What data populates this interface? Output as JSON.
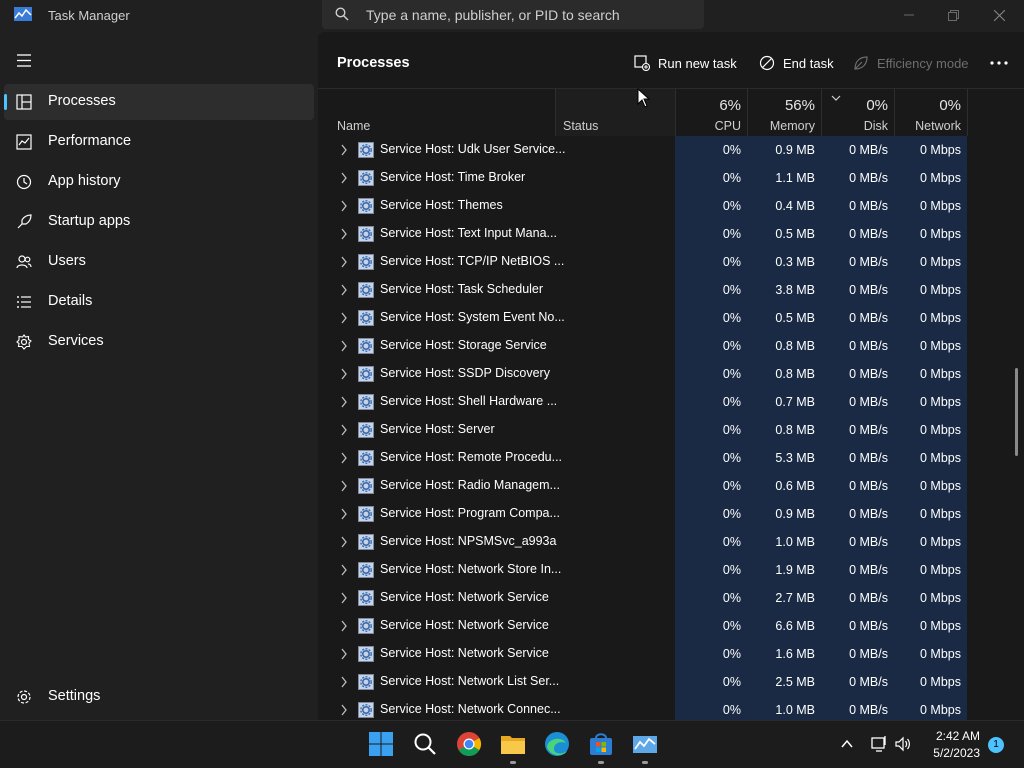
{
  "window": {
    "title": "Task Manager"
  },
  "search": {
    "placeholder": "Type a name, publisher, or PID to search"
  },
  "sidebar": {
    "items": [
      {
        "label": "Processes",
        "icon": "processes-icon",
        "active": true
      },
      {
        "label": "Performance",
        "icon": "performance-icon"
      },
      {
        "label": "App history",
        "icon": "app-history-icon"
      },
      {
        "label": "Startup apps",
        "icon": "startup-apps-icon"
      },
      {
        "label": "Users",
        "icon": "users-icon"
      },
      {
        "label": "Details",
        "icon": "details-icon"
      },
      {
        "label": "Services",
        "icon": "services-icon"
      }
    ],
    "settings_label": "Settings"
  },
  "toolbar": {
    "title": "Processes",
    "run_new_task": "Run new task",
    "end_task": "End task",
    "efficiency_mode": "Efficiency mode"
  },
  "columns": {
    "name": "Name",
    "status": "Status",
    "cpu": {
      "pct": "6%",
      "label": "CPU"
    },
    "memory": {
      "pct": "56%",
      "label": "Memory"
    },
    "disk": {
      "pct": "0%",
      "label": "Disk"
    },
    "network": {
      "pct": "0%",
      "label": "Network"
    }
  },
  "processes": [
    {
      "name": "Service Host: Udk User Service...",
      "cpu": "0%",
      "memory": "0.9 MB",
      "disk": "0 MB/s",
      "network": "0 Mbps"
    },
    {
      "name": "Service Host: Time Broker",
      "cpu": "0%",
      "memory": "1.1 MB",
      "disk": "0 MB/s",
      "network": "0 Mbps"
    },
    {
      "name": "Service Host: Themes",
      "cpu": "0%",
      "memory": "0.4 MB",
      "disk": "0 MB/s",
      "network": "0 Mbps"
    },
    {
      "name": "Service Host: Text Input Mana...",
      "cpu": "0%",
      "memory": "0.5 MB",
      "disk": "0 MB/s",
      "network": "0 Mbps"
    },
    {
      "name": "Service Host: TCP/IP NetBIOS ...",
      "cpu": "0%",
      "memory": "0.3 MB",
      "disk": "0 MB/s",
      "network": "0 Mbps"
    },
    {
      "name": "Service Host: Task Scheduler",
      "cpu": "0%",
      "memory": "3.8 MB",
      "disk": "0 MB/s",
      "network": "0 Mbps"
    },
    {
      "name": "Service Host: System Event No...",
      "cpu": "0%",
      "memory": "0.5 MB",
      "disk": "0 MB/s",
      "network": "0 Mbps"
    },
    {
      "name": "Service Host: Storage Service",
      "cpu": "0%",
      "memory": "0.8 MB",
      "disk": "0 MB/s",
      "network": "0 Mbps"
    },
    {
      "name": "Service Host: SSDP Discovery",
      "cpu": "0%",
      "memory": "0.8 MB",
      "disk": "0 MB/s",
      "network": "0 Mbps"
    },
    {
      "name": "Service Host: Shell Hardware ...",
      "cpu": "0%",
      "memory": "0.7 MB",
      "disk": "0 MB/s",
      "network": "0 Mbps"
    },
    {
      "name": "Service Host: Server",
      "cpu": "0%",
      "memory": "0.8 MB",
      "disk": "0 MB/s",
      "network": "0 Mbps"
    },
    {
      "name": "Service Host: Remote Procedu...",
      "cpu": "0%",
      "memory": "5.3 MB",
      "disk": "0 MB/s",
      "network": "0 Mbps"
    },
    {
      "name": "Service Host: Radio Managem...",
      "cpu": "0%",
      "memory": "0.6 MB",
      "disk": "0 MB/s",
      "network": "0 Mbps"
    },
    {
      "name": "Service Host: Program Compa...",
      "cpu": "0%",
      "memory": "0.9 MB",
      "disk": "0 MB/s",
      "network": "0 Mbps"
    },
    {
      "name": "Service Host: NPSMSvc_a993a",
      "cpu": "0%",
      "memory": "1.0 MB",
      "disk": "0 MB/s",
      "network": "0 Mbps"
    },
    {
      "name": "Service Host: Network Store In...",
      "cpu": "0%",
      "memory": "1.9 MB",
      "disk": "0 MB/s",
      "network": "0 Mbps"
    },
    {
      "name": "Service Host: Network Service",
      "cpu": "0%",
      "memory": "2.7 MB",
      "disk": "0 MB/s",
      "network": "0 Mbps"
    },
    {
      "name": "Service Host: Network Service",
      "cpu": "0%",
      "memory": "6.6 MB",
      "disk": "0 MB/s",
      "network": "0 Mbps"
    },
    {
      "name": "Service Host: Network Service",
      "cpu": "0%",
      "memory": "1.6 MB",
      "disk": "0 MB/s",
      "network": "0 Mbps"
    },
    {
      "name": "Service Host: Network List Ser...",
      "cpu": "0%",
      "memory": "2.5 MB",
      "disk": "0 MB/s",
      "network": "0 Mbps"
    },
    {
      "name": "Service Host: Network Connec...",
      "cpu": "0%",
      "memory": "1.0 MB",
      "disk": "0 MB/s",
      "network": "0 Mbps"
    }
  ],
  "taskbar": {
    "apps": [
      "start-icon",
      "search-icon",
      "chrome-icon",
      "file-explorer-icon",
      "edge-icon",
      "microsoft-store-icon",
      "task-manager-icon"
    ],
    "time": "2:42 AM",
    "date": "5/2/2023",
    "notification_count": "1"
  },
  "colors": {
    "accent": "#4cc2ff",
    "heat_cell": "#1a2a44",
    "background": "#191919"
  }
}
